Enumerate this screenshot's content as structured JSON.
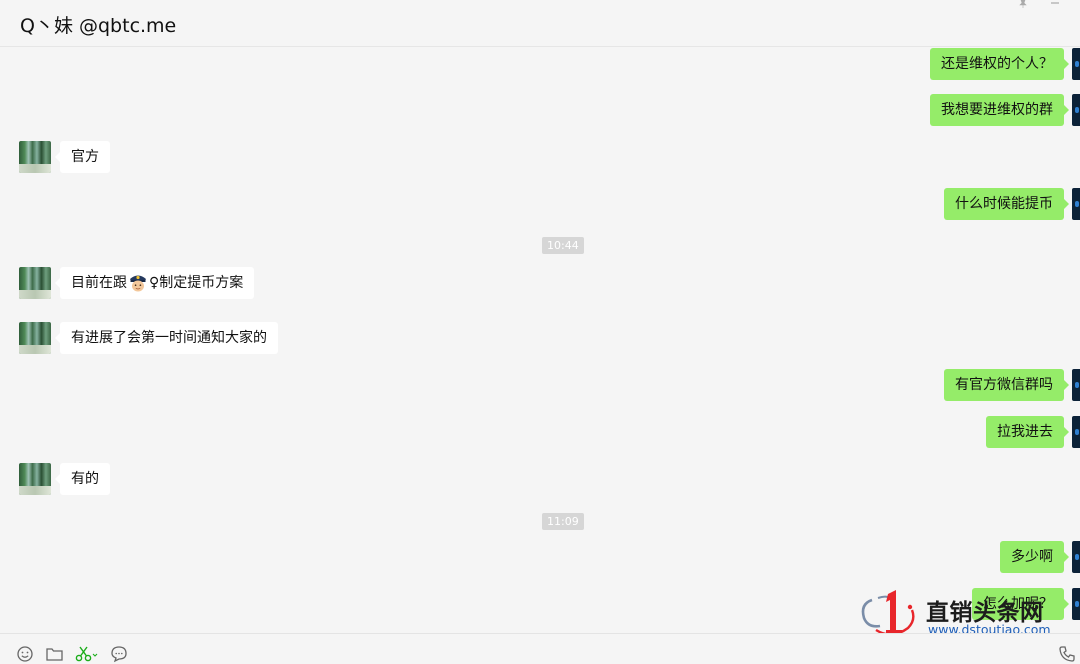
{
  "window": {
    "title": "Q丶妹 @qbtc.me"
  },
  "messages": [
    {
      "side": "out",
      "text": "还是维权的个人？"
    },
    {
      "side": "out",
      "text": "我想要进维权的群"
    },
    {
      "side": "in",
      "text": "官方"
    },
    {
      "side": "out",
      "text": "什么时候能提币"
    },
    {
      "side": "time",
      "text": "10:44"
    },
    {
      "side": "in",
      "text_before": "目前在跟",
      "emoji": "police-officer",
      "text_after": "♀制定提币方案"
    },
    {
      "side": "in",
      "text": "有进展了会第一时间通知大家的"
    },
    {
      "side": "out",
      "text": "有官方微信群吗"
    },
    {
      "side": "out",
      "text": "拉我进去"
    },
    {
      "side": "in",
      "text": "有的"
    },
    {
      "side": "time",
      "text": "11:09"
    },
    {
      "side": "out",
      "text": "多少啊"
    },
    {
      "side": "out",
      "text": "怎么加呢？"
    }
  ],
  "toolbar": {
    "icons": [
      "emoji-icon",
      "folder-icon",
      "scissors-icon",
      "chat-bubble-icon",
      "phone-icon"
    ]
  },
  "watermark": {
    "title": "直销头条网",
    "url": "www.dstoutiao.com"
  },
  "colors": {
    "outgoing_bubble": "#95ec69",
    "incoming_bubble": "#ffffff",
    "background": "#f5f5f5",
    "watermark_url": "#1f5fb8",
    "watermark_logo_red": "#e8262b"
  }
}
